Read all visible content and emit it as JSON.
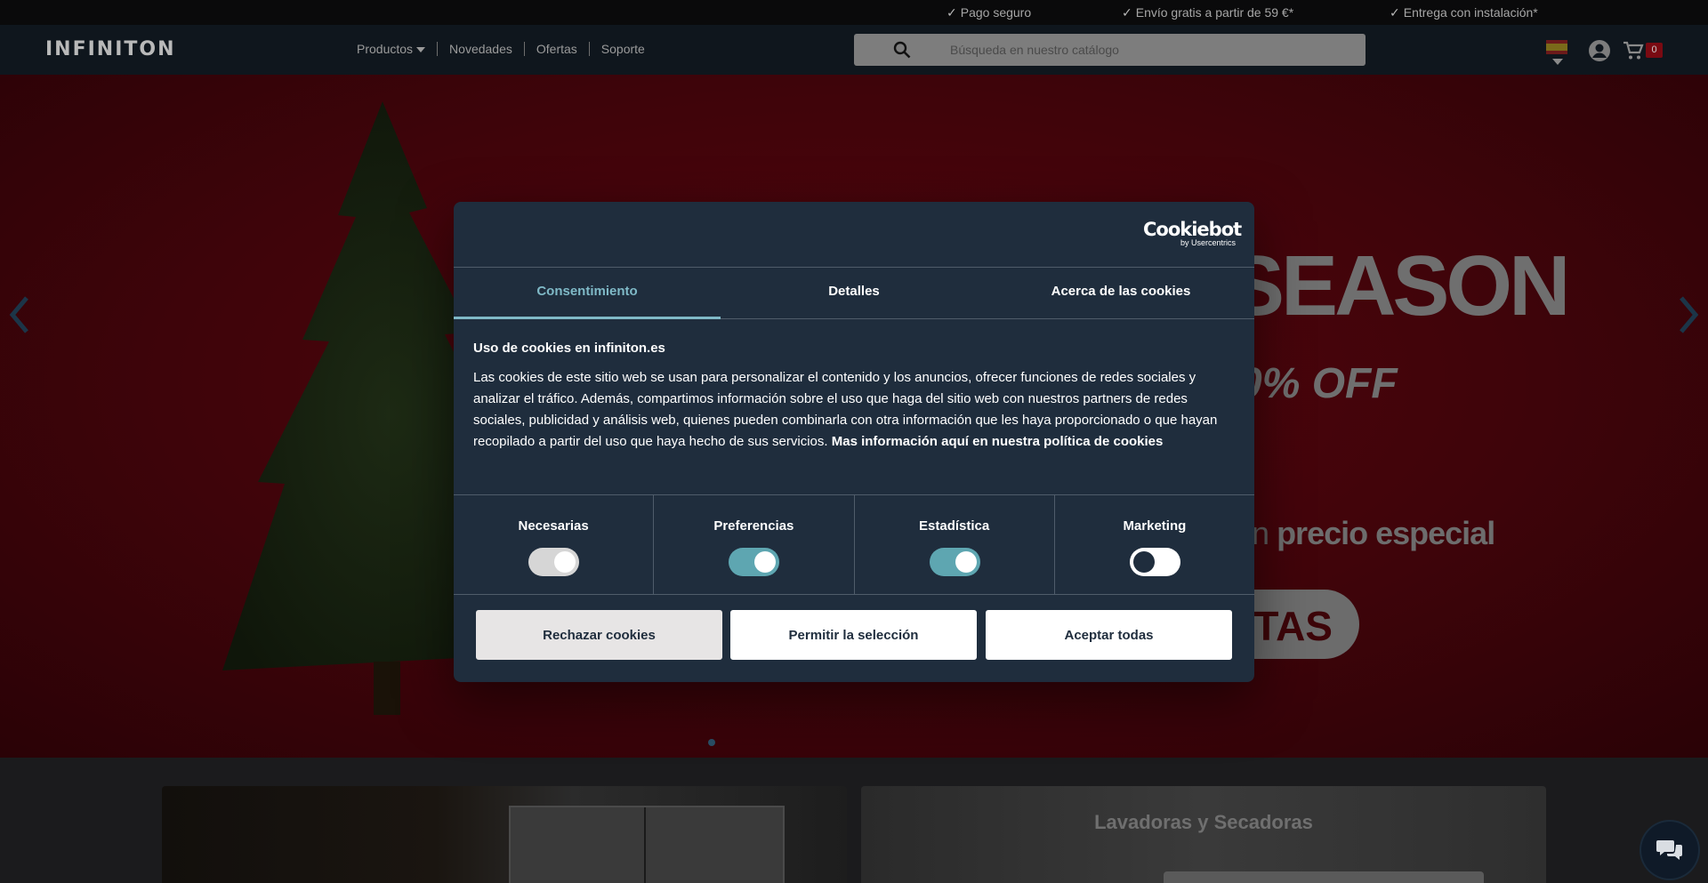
{
  "topbar": {
    "usps": [
      "Pago seguro",
      "Envío gratis a partir de 59 €*",
      "Entrega con instalación*"
    ]
  },
  "header": {
    "logo": "INFINITON",
    "nav": [
      "Productos",
      "Novedades",
      "Ofertas",
      "Soporte"
    ],
    "search_placeholder": "Búsqueda en nuestro catálogo",
    "cart_count": "0"
  },
  "hero": {
    "title": "SEASON",
    "discount": "0% OFF",
    "subtitle_light": "un",
    "subtitle_bold": "precio especial",
    "cta": "TAS"
  },
  "categories": {
    "card2_title": "Lavadoras y Secadoras"
  },
  "cookie_dialog": {
    "brand": "Cookiebot",
    "brand_sub": "by Usercentrics",
    "tabs": [
      {
        "label": "Consentimiento",
        "active": true
      },
      {
        "label": "Detalles",
        "active": false
      },
      {
        "label": "Acerca de las cookies",
        "active": false
      }
    ],
    "heading": "Uso de cookies en infiniton.es",
    "body": "Las cookies de este sitio web se usan para personalizar el contenido y los anuncios, ofrecer funciones de redes sociales y analizar el tráfico. Además, compartimos información sobre el uso que haga del sitio web con nuestros partners de redes sociales, publicidad y análisis web, quienes pueden combinarla con otra información que les haya proporcionado o que hayan recopilado a partir del uso que haya hecho de sus servicios.",
    "link": "Mas información aquí en nuestra política de cookies",
    "toggles": [
      {
        "label": "Necesarias",
        "state": "on-disabled"
      },
      {
        "label": "Preferencias",
        "state": "on"
      },
      {
        "label": "Estadística",
        "state": "on"
      },
      {
        "label": "Marketing",
        "state": "off"
      }
    ],
    "buttons": {
      "reject": "Rechazar cookies",
      "selection": "Permitir la selección",
      "accept": "Aceptar todas"
    }
  },
  "colors": {
    "dialog_bg": "#1f2d3d",
    "accent": "#7fb9c7",
    "toggle_on": "#5ea6b1"
  }
}
